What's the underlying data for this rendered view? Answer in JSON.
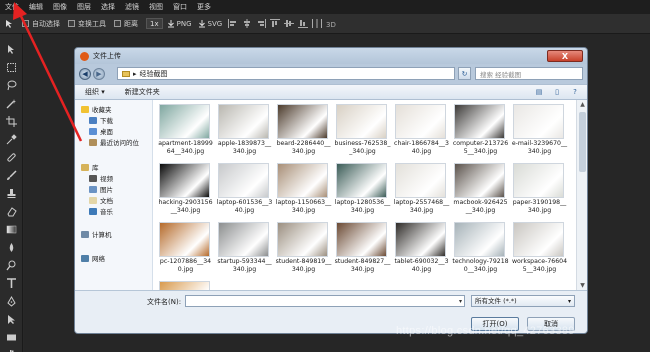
{
  "menu": [
    "文件",
    "编辑",
    "图像",
    "图层",
    "选择",
    "滤镜",
    "视图",
    "窗口",
    "更多"
  ],
  "options": {
    "auto_select": "自动选择",
    "transform_tools": "变换工具",
    "distance": "距离",
    "zoom": "1x",
    "png": "PNG",
    "svg": "SVG"
  },
  "dialog": {
    "title": "文件上传",
    "close": "X",
    "path": "经验截图",
    "search_placeholder": "搜索 经验截图",
    "organize": "组织 ▾",
    "new_folder": "新建文件夹",
    "nav": {
      "favorites": "收藏夹",
      "downloads": "下载",
      "desktop": "桌面",
      "recent": "最近访问的位",
      "library": "库",
      "videos": "视频",
      "pictures": "图片",
      "documents": "文档",
      "music": "音乐",
      "computer": "计算机",
      "network": "网络"
    },
    "files": [
      {
        "name": "apartment-1899964__340.jpg",
        "color": "#7fa7a0"
      },
      {
        "name": "apple-1839873__340.jpg",
        "color": "#b9b7b0"
      },
      {
        "name": "beard-2286440__340.jpg",
        "color": "#4c3b2c"
      },
      {
        "name": "business-762538__340.jpg",
        "color": "#d8d0c4"
      },
      {
        "name": "chair-1866784__340.jpg",
        "color": "#e4dfd8"
      },
      {
        "name": "computer-2137265__340.jpg",
        "color": "#3c3a38"
      },
      {
        "name": "e-mail-3239670__340.jpg",
        "color": "#e9e7e4"
      },
      {
        "name": "hacking-2903156__340.jpg",
        "color": "#0a0a0a"
      },
      {
        "name": "laptop-601536__340.jpg",
        "color": "#c7c9cb"
      },
      {
        "name": "laptop-1150663__340.jpg",
        "color": "#a88f77"
      },
      {
        "name": "laptop-1280536__340.jpg",
        "color": "#3b5c57"
      },
      {
        "name": "laptop-2557468__340.jpg",
        "color": "#e3e0da"
      },
      {
        "name": "macbook-926425__340.jpg",
        "color": "#5a524b"
      },
      {
        "name": "paper-3190198__340.jpg",
        "color": "#d9dbd6"
      },
      {
        "name": "pc-1207886__340.jpg",
        "color": "#b56a2a"
      },
      {
        "name": "startup-593344__340.jpg",
        "color": "#8c8e8f"
      },
      {
        "name": "student-849819__340.jpg",
        "color": "#9b8f80"
      },
      {
        "name": "student-849827__340.jpg",
        "color": "#6b4a34"
      },
      {
        "name": "tablet-690032__340.jpg",
        "color": "#2f2c29"
      },
      {
        "name": "technology-792180__340.jpg",
        "color": "#a6b2b8"
      },
      {
        "name": "workspace-766045__340.jpg",
        "color": "#c9c6c1"
      },
      {
        "name": "",
        "color": "#d89a4d"
      }
    ],
    "filename_label": "文件名(N):",
    "filter": "所有文件 (*.*)",
    "open": "打开(O)",
    "cancel": "取消"
  },
  "watermark": "https://blog.csdn.net/qq_42763389"
}
